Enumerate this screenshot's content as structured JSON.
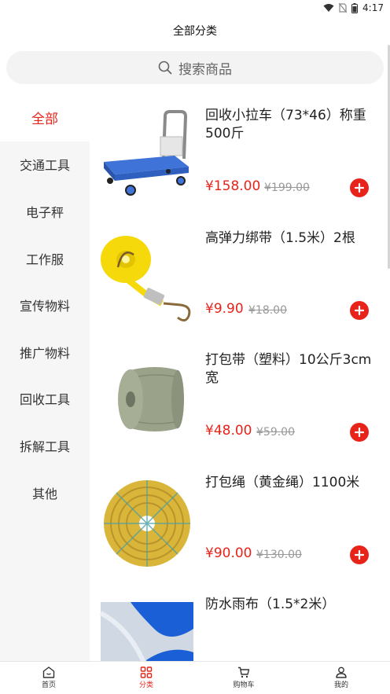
{
  "status_bar": {
    "time": "4:17"
  },
  "header": {
    "title": "全部分类"
  },
  "search": {
    "placeholder": "搜索商品"
  },
  "sidebar": {
    "items": [
      {
        "label": "全部",
        "active": true
      },
      {
        "label": "交通工具"
      },
      {
        "label": "电子秤"
      },
      {
        "label": "工作服"
      },
      {
        "label": "宣传物料"
      },
      {
        "label": "推广物料"
      },
      {
        "label": "回收工具"
      },
      {
        "label": "拆解工具"
      },
      {
        "label": "其他"
      }
    ]
  },
  "products": [
    {
      "name": "回收小拉车（73*46）称重500斤",
      "price": "¥158.00",
      "old_price": "¥199.00",
      "image": "cart-image"
    },
    {
      "name": "高弹力绑带（1.5米）2根",
      "price": "¥9.90",
      "old_price": "¥18.00",
      "image": "strap-image"
    },
    {
      "name": "打包带（塑料）10公斤3cm宽",
      "price": "¥48.00",
      "old_price": "¥59.00",
      "image": "packing-tape-image"
    },
    {
      "name": "打包绳（黄金绳）1100米",
      "price": "¥90.00",
      "old_price": "¥130.00",
      "image": "rope-image"
    },
    {
      "name": "防水雨布（1.5*2米）",
      "price": "",
      "old_price": "",
      "image": "tarp-image"
    }
  ],
  "tab_bar": {
    "tabs": [
      {
        "label": "首页",
        "icon": "home-icon"
      },
      {
        "label": "分类",
        "icon": "category-icon",
        "active": true
      },
      {
        "label": "购物车",
        "icon": "cart-icon"
      },
      {
        "label": "我的",
        "icon": "user-icon"
      }
    ]
  },
  "colors": {
    "accent": "#e8231a",
    "sidebar_bg": "#f6f6f6",
    "search_bg": "#f3f3f3"
  }
}
